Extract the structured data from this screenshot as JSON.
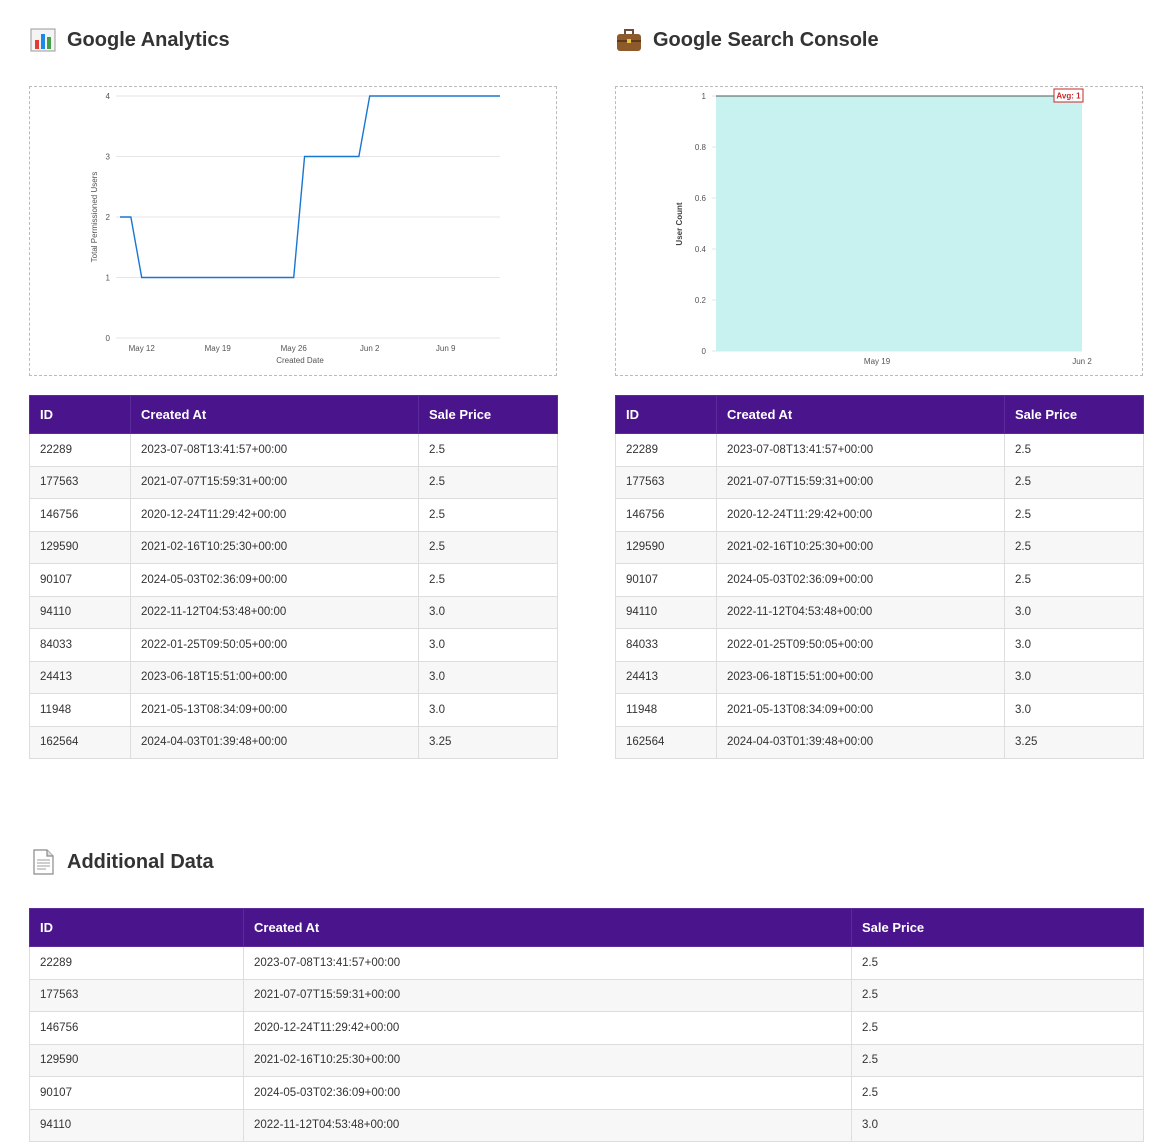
{
  "sections": {
    "ga": {
      "title": "Google Analytics",
      "icon": "bar-chart-icon"
    },
    "gsc": {
      "title": "Google Search Console",
      "icon": "briefcase-icon"
    },
    "extra": {
      "title": "Additional Data",
      "icon": "document-icon"
    }
  },
  "columns": [
    "ID",
    "Created At",
    "Sale Price"
  ],
  "rows": [
    [
      "22289",
      "2023-07-08T13:41:57+00:00",
      "2.5"
    ],
    [
      "177563",
      "2021-07-07T15:59:31+00:00",
      "2.5"
    ],
    [
      "146756",
      "2020-12-24T11:29:42+00:00",
      "2.5"
    ],
    [
      "129590",
      "2021-02-16T10:25:30+00:00",
      "2.5"
    ],
    [
      "90107",
      "2024-05-03T02:36:09+00:00",
      "2.5"
    ],
    [
      "94110",
      "2022-11-12T04:53:48+00:00",
      "3.0"
    ],
    [
      "84033",
      "2022-01-25T09:50:05+00:00",
      "3.0"
    ],
    [
      "24413",
      "2023-06-18T15:51:00+00:00",
      "3.0"
    ],
    [
      "11948",
      "2021-05-13T08:34:09+00:00",
      "3.0"
    ],
    [
      "162564",
      "2024-04-03T01:39:48+00:00",
      "3.25"
    ]
  ],
  "extra_rows_visible": 6,
  "chart_data": [
    {
      "type": "line",
      "xlabel": "Created Date",
      "ylabel": "Total Permissioned Users",
      "ylim": [
        0,
        4
      ],
      "yticks": [
        "0",
        "1",
        "2",
        "3",
        "4"
      ],
      "xticks": [
        "May 12",
        "May 19",
        "May 26",
        "Jun 2",
        "Jun 9"
      ],
      "color": "#1976d2",
      "grid": true,
      "x": [
        "May 10",
        "May 11",
        "May 12",
        "May 26",
        "May 27",
        "Jun 1",
        "Jun 2",
        "Jun 14"
      ],
      "y": [
        2,
        2,
        1,
        1,
        3,
        3,
        4,
        4
      ]
    },
    {
      "type": "area",
      "xlabel": "",
      "ylabel": "User Count",
      "ylim": [
        0,
        1
      ],
      "yticks": [
        "0",
        "0.2",
        "0.4",
        "0.6",
        "0.8",
        "1"
      ],
      "xticks": [
        "May 19",
        "Jun 2"
      ],
      "fill": "#c8f2f0",
      "stroke": "#555555",
      "grid": true,
      "x": [
        "May 8",
        "Jun 2"
      ],
      "y": [
        1,
        1
      ],
      "annotation": "Avg: 1",
      "annotation_color": "#c62828"
    }
  ]
}
